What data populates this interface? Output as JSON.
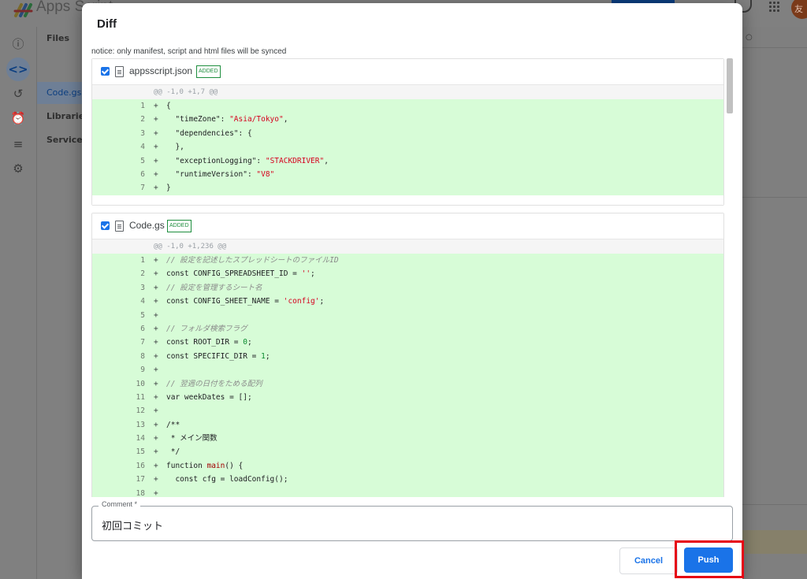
{
  "background": {
    "app_title": "Apps Script",
    "avatar_text": "友",
    "files_header": "Files",
    "file_code": "Code.gs",
    "libraries": "Libraries",
    "services": "Services"
  },
  "dialog": {
    "title": "Diff",
    "notice": "notice: only manifest, script and html files will be synced",
    "files": [
      {
        "name": "appsscript.json",
        "badge": "ADDED",
        "checked": true,
        "hunk": "@@ -1,0 +1,7 @@",
        "lines": [
          {
            "n": "1",
            "code": "{"
          },
          {
            "n": "2",
            "code": "  \"timeZone\": \"Asia/Tokyo\","
          },
          {
            "n": "3",
            "code": "  \"dependencies\": {"
          },
          {
            "n": "4",
            "code": "  },"
          },
          {
            "n": "5",
            "code": "  \"exceptionLogging\": \"STACKDRIVER\","
          },
          {
            "n": "6",
            "code": "  \"runtimeVersion\": \"V8\""
          },
          {
            "n": "7",
            "code": "}"
          }
        ]
      },
      {
        "name": "Code.gs",
        "badge": "ADDED",
        "checked": true,
        "hunk": "@@ -1,0 +1,236 @@",
        "lines": [
          {
            "n": "1",
            "code": "// 設定を記述したスプレッドシートのファイルID"
          },
          {
            "n": "2",
            "code": "const CONFIG_SPREADSHEET_ID = '';"
          },
          {
            "n": "3",
            "code": "// 設定を管理するシート名"
          },
          {
            "n": "4",
            "code": "const CONFIG_SHEET_NAME = 'config';"
          },
          {
            "n": "5",
            "code": ""
          },
          {
            "n": "6",
            "code": "// フォルダ検索フラグ"
          },
          {
            "n": "7",
            "code": "const ROOT_DIR = 0;"
          },
          {
            "n": "8",
            "code": "const SPECIFIC_DIR = 1;"
          },
          {
            "n": "9",
            "code": ""
          },
          {
            "n": "10",
            "code": "// 翌週の日付をためる配列"
          },
          {
            "n": "11",
            "code": "var weekDates = [];"
          },
          {
            "n": "12",
            "code": ""
          },
          {
            "n": "13",
            "code": "/**"
          },
          {
            "n": "14",
            "code": " * メイン関数"
          },
          {
            "n": "15",
            "code": " */"
          },
          {
            "n": "16",
            "code": "function main() {"
          },
          {
            "n": "17",
            "code": "  const cfg = loadConfig();"
          },
          {
            "n": "18",
            "code": ""
          }
        ]
      }
    ],
    "comment_label": "Comment *",
    "comment_value": "初回コミット",
    "cancel_label": "Cancel",
    "push_label": "Push"
  }
}
